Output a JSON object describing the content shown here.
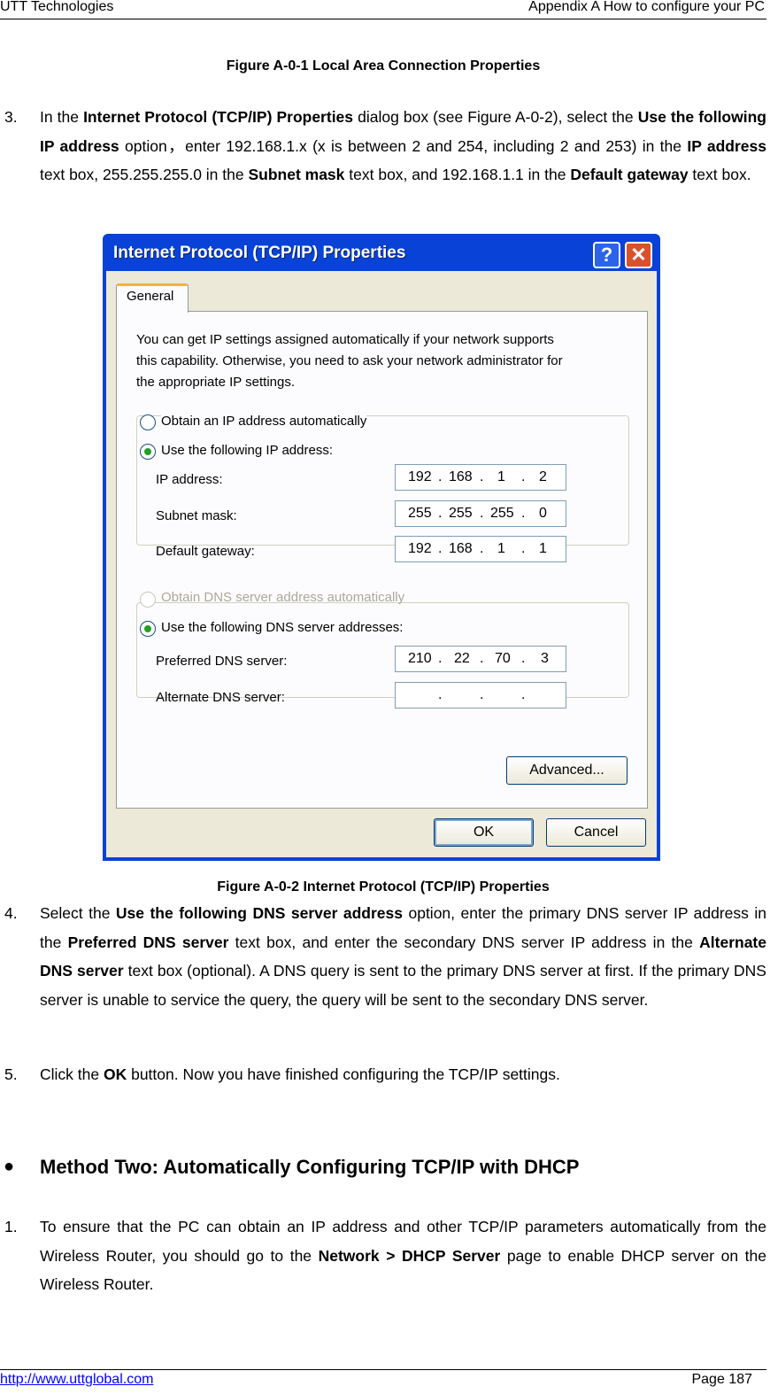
{
  "header": {
    "left": "UTT Technologies",
    "right": "Appendix A How to configure your PC"
  },
  "caption1": "Figure A-0-1 Local Area Connection Properties",
  "step3": {
    "num": "3.",
    "t1": "In the ",
    "b1": "Internet Protocol (TCP/IP) Properties",
    "t2": " dialog box (see Figure A-0-2), select the ",
    "b2": "Use the following IP address",
    "t3": " option，enter 192.168.1.x (x is between 2 and 254, including 2 and 253) in the ",
    "b3": "IP address",
    "t4": " text box, 255.255.255.0 in the ",
    "b4": "Subnet mask",
    "t5": " text box, and 192.168.1.1 in the ",
    "b5": "Default gateway",
    "t6": " text box."
  },
  "dialog": {
    "title": "Internet Protocol (TCP/IP) Properties",
    "help": "?",
    "close": "✕",
    "tab": "General",
    "desc1": "You can get IP settings assigned automatically if your network supports",
    "desc2": "this capability. Otherwise, you need to ask your network administrator for",
    "desc3": "the appropriate IP settings.",
    "radio_auto_ip": "Obtain an IP address automatically",
    "radio_manual_ip": "Use the following IP address:",
    "ip_label": "IP address:",
    "ip": [
      "192",
      "168",
      "1",
      "2"
    ],
    "mask_label": "Subnet mask:",
    "mask": [
      "255",
      "255",
      "255",
      "0"
    ],
    "gw_label": "Default gateway:",
    "gw": [
      "192",
      "168",
      "1",
      "1"
    ],
    "radio_auto_dns": "Obtain DNS server address automatically",
    "radio_manual_dns": "Use the following DNS server addresses:",
    "pdns_label": "Preferred DNS server:",
    "pdns": [
      "210",
      "22",
      "70",
      "3"
    ],
    "adns_label": "Alternate DNS server:",
    "adns": [
      "",
      "",
      "",
      ""
    ],
    "advanced": "Advanced...",
    "ok": "OK",
    "cancel": "Cancel",
    "colors": {
      "titlebar": "#0842d6",
      "client": "#ece9d8",
      "close": "#d9512c"
    }
  },
  "caption2": "Figure A-0-2 Internet Protocol (TCP/IP) Properties",
  "step4": {
    "num": "4.",
    "t1": "Select the ",
    "b1": "Use the following DNS server address",
    "t2": " option, enter the primary DNS server IP address in the ",
    "b2": "Preferred DNS server",
    "t3": " text box, and enter the secondary DNS server IP address in the ",
    "b3": "Alternate DNS server",
    "t4": " text box (optional). A DNS query is sent to the primary DNS server at first. If the primary DNS server is unable to service the query, the query will be sent to the secondary DNS server."
  },
  "step5": {
    "num": "5.",
    "t1": "Click the ",
    "b1": "OK",
    "t2": " button. Now you have finished configuring the TCP/IP settings."
  },
  "method": {
    "bullet": "●",
    "title": "Method Two: Automatically Configuring TCP/IP with DHCP"
  },
  "step1": {
    "num": "1.",
    "t1": "To ensure that the PC can obtain an IP address and other TCP/IP parameters automatically from the Wireless Router, you should go to the ",
    "b1": "Network > DHCP Server",
    "t2": " page to enable DHCP server on the Wireless Router."
  },
  "footer": {
    "link": "http://www.uttglobal.com",
    "page": "Page 187"
  }
}
